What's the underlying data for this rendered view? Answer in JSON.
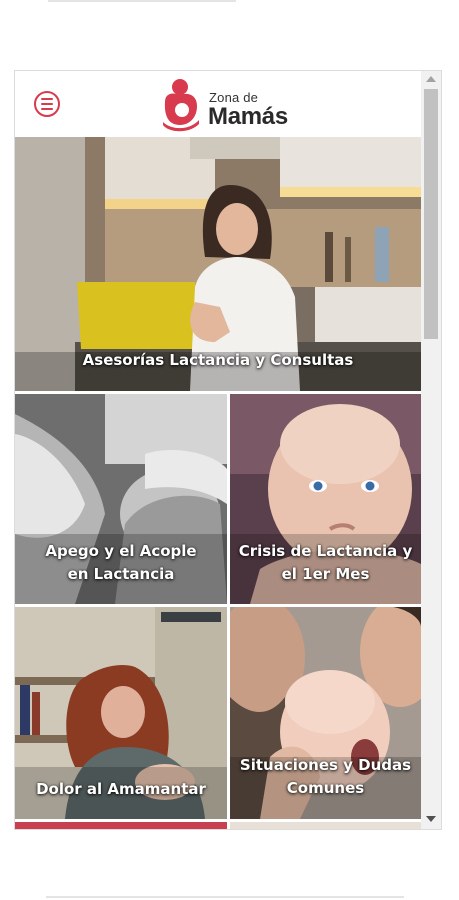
{
  "logo": {
    "small_text": "Zona de",
    "big_text": "Mamás",
    "color": "#d83a4e"
  },
  "header": {
    "menu_icon": "hamburger-menu-icon"
  },
  "tiles": [
    {
      "id": "asesorias",
      "label_lines": [
        "Asesorías Lactancia y Consultas"
      ]
    },
    {
      "id": "apego",
      "label_lines": [
        "Apego y el Acople",
        "en Lactancia"
      ]
    },
    {
      "id": "crisis",
      "label_lines": [
        "Crisis de Lactancia y",
        "el 1er Mes"
      ]
    },
    {
      "id": "dolor",
      "label_lines": [
        "Dolor al Amamantar"
      ]
    },
    {
      "id": "situaciones",
      "label_lines": [
        "Situaciones y Dudas",
        "Comunes"
      ]
    }
  ],
  "colors": {
    "accent": "#d83a4e",
    "scrollbar_track": "#f1f1f1",
    "scrollbar_thumb": "#c1c1c1"
  }
}
